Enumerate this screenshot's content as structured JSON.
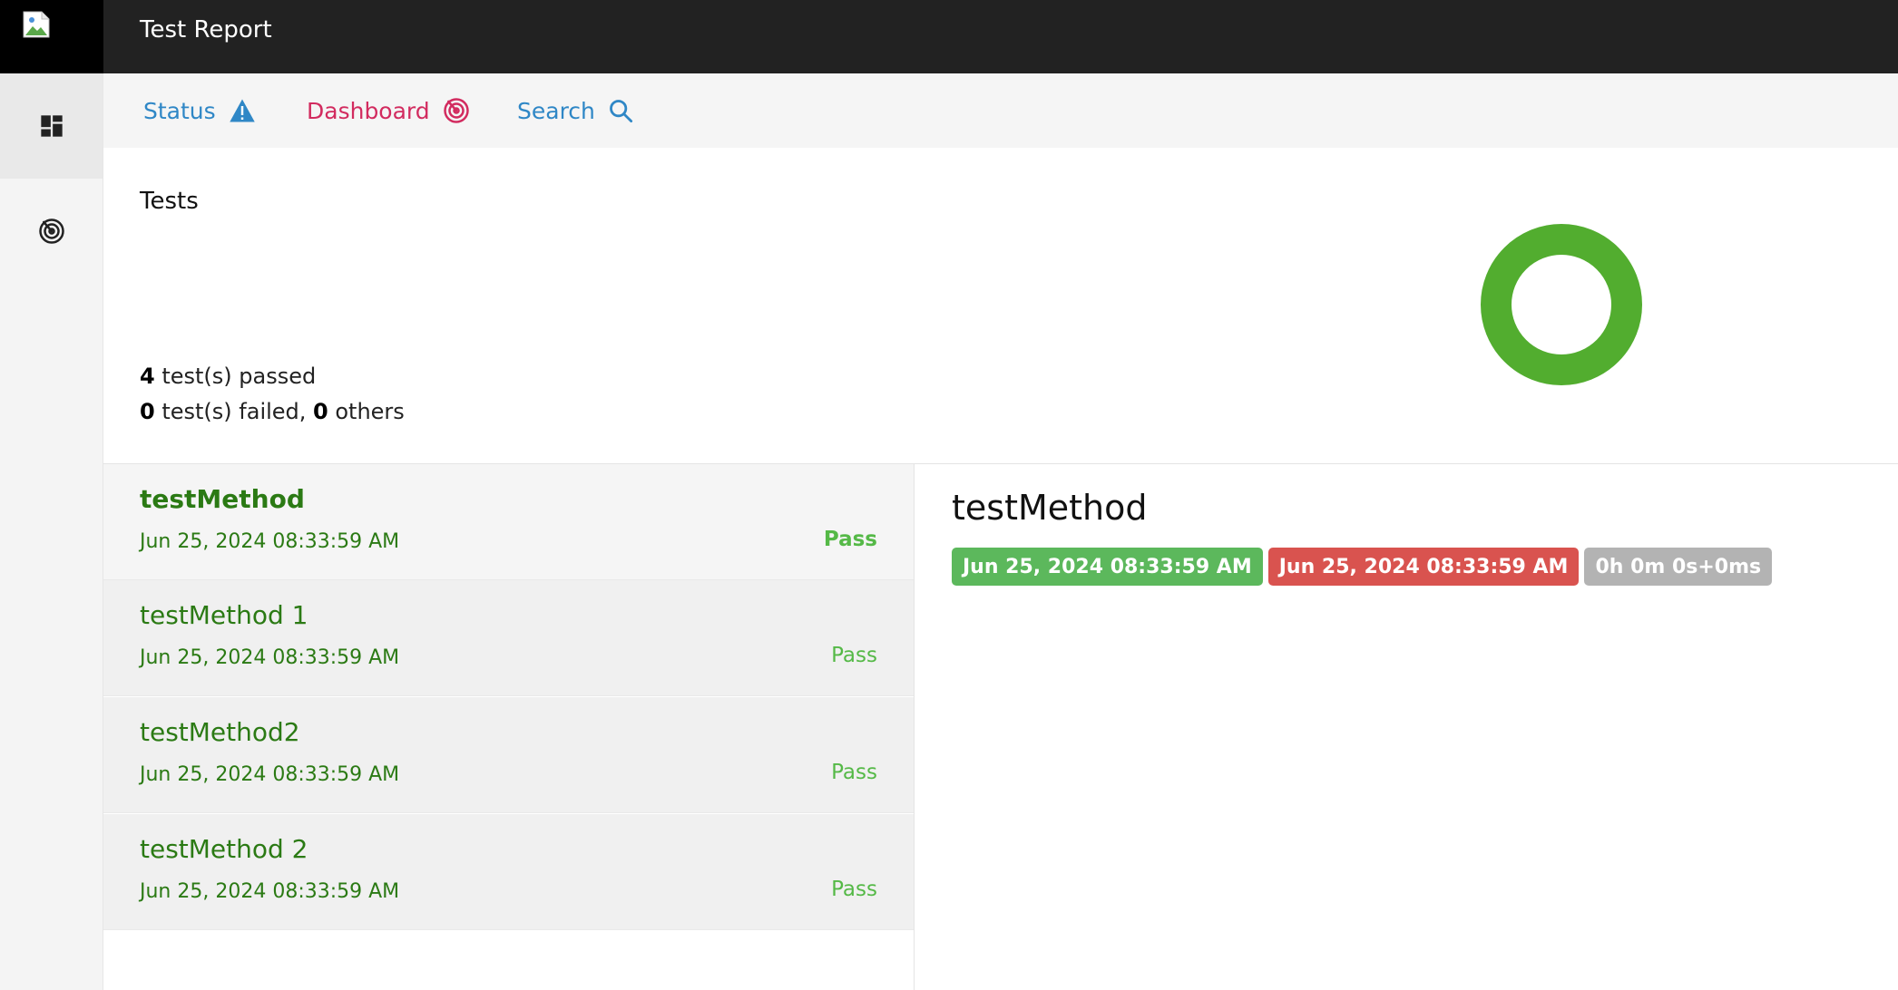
{
  "app": {
    "title": "Test Report"
  },
  "sidebar": {
    "items": [
      {
        "icon": "dashboard-grid-icon",
        "active": true
      },
      {
        "icon": "radar-icon",
        "active": false
      }
    ]
  },
  "nav": {
    "status_label": "Status",
    "dashboard_label": "Dashboard",
    "search_label": "Search",
    "colors": {
      "status": "#2f87c6",
      "dashboard": "#d22b5f",
      "search": "#2f87c6"
    }
  },
  "summary": {
    "title": "Tests",
    "passed_count": "4",
    "passed_text": " test(s) passed",
    "failed_count": "0",
    "failed_text": " test(s) failed, ",
    "others_count": "0",
    "others_text": " others",
    "chart_color": "#52ad2f"
  },
  "chart_data": {
    "type": "pie",
    "categories": [
      "passed",
      "failed",
      "others"
    ],
    "values": [
      4,
      0,
      0
    ],
    "colors": [
      "#52ad2f",
      "#e2564b",
      "#9e9e9e"
    ]
  },
  "tests": [
    {
      "name": "testMethod",
      "time": "Jun 25, 2024 08:33:59 AM",
      "status": "Pass"
    },
    {
      "name": "testMethod 1",
      "time": "Jun 25, 2024 08:33:59 AM",
      "status": "Pass"
    },
    {
      "name": "testMethod2",
      "time": "Jun 25, 2024 08:33:59 AM",
      "status": "Pass"
    },
    {
      "name": "testMethod 2",
      "time": "Jun 25, 2024 08:33:59 AM",
      "status": "Pass"
    }
  ],
  "detail": {
    "title": "testMethod",
    "start_time": "Jun 25, 2024 08:33:59 AM",
    "end_time": "Jun 25, 2024 08:33:59 AM",
    "duration": "0h 0m 0s+0ms",
    "colors": {
      "start": "#5cb85c",
      "end": "#d9534f",
      "duration": "#b3b3b3"
    }
  }
}
